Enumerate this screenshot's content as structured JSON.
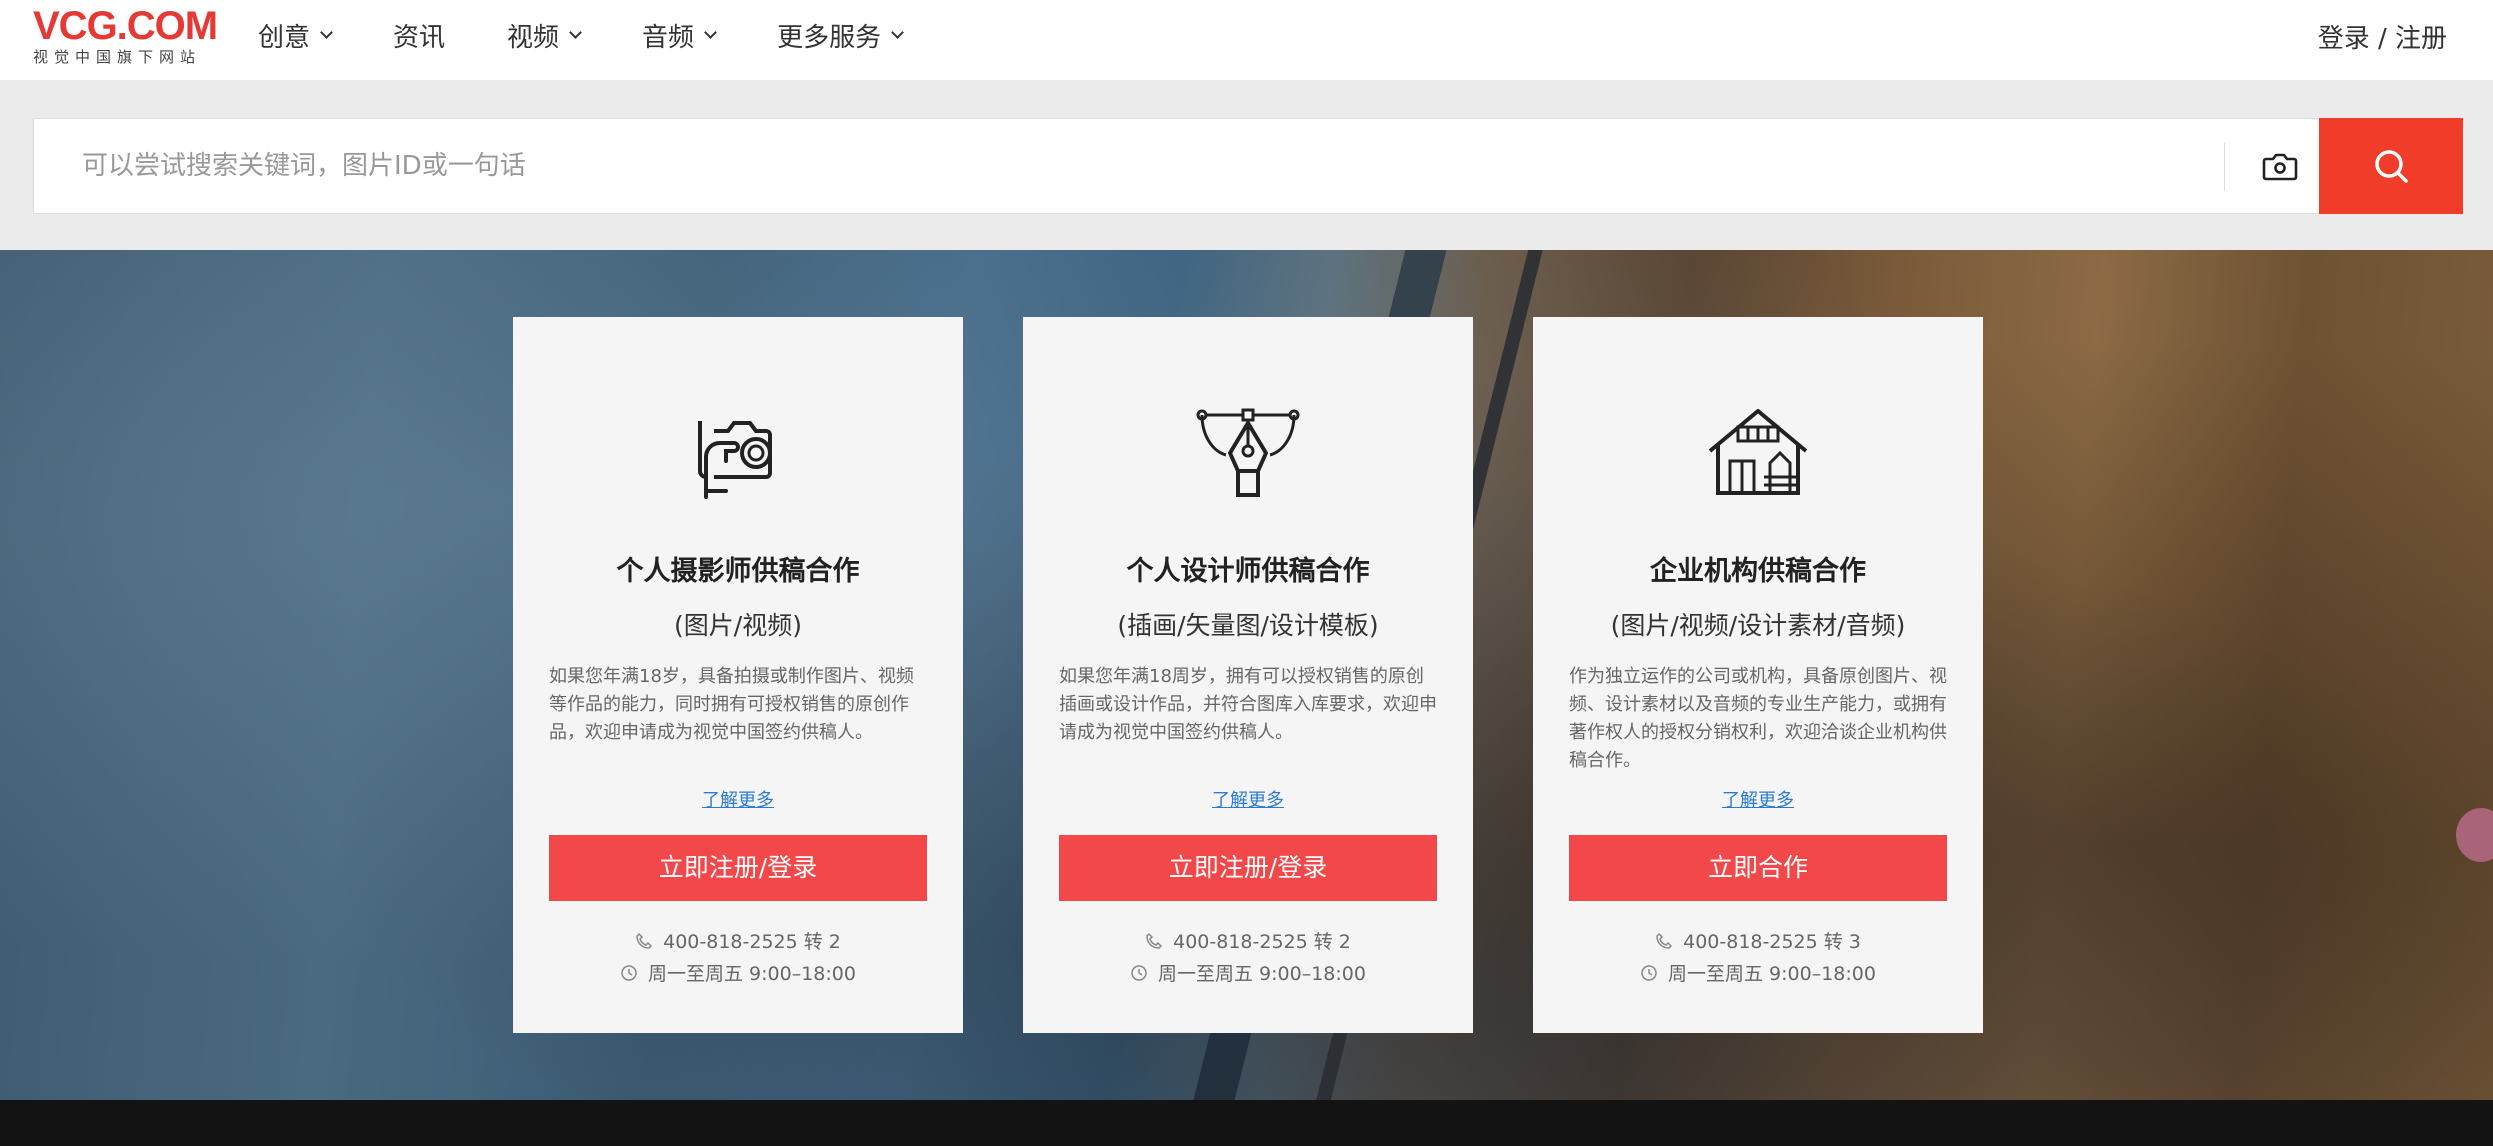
{
  "logo": {
    "main": "VCG.COM",
    "sub": "视觉中国旗下网站"
  },
  "nav": [
    {
      "label": "创意",
      "has_dropdown": true
    },
    {
      "label": "资讯",
      "has_dropdown": false
    },
    {
      "label": "视频",
      "has_dropdown": true
    },
    {
      "label": "音频",
      "has_dropdown": true
    },
    {
      "label": "更多服务",
      "has_dropdown": true
    }
  ],
  "login_label": "登录 / 注册",
  "search": {
    "placeholder": "可以尝试搜索关键词，图片ID或一句话",
    "value": ""
  },
  "colors": {
    "brand": "#e53935",
    "search_button": "#f03c28",
    "card_button": "#f2484a",
    "link": "#2a7bd4"
  },
  "cards": [
    {
      "icon": "camera-hand-icon",
      "title": "个人摄影师供稿合作",
      "subtitle": "(图片/视频)",
      "desc": "如果您年满18岁，具备拍摄或制作图片、视频等作品的能力，同时拥有可授权销售的原创作品，欢迎申请成为视觉中国签约供稿人。",
      "more": "了解更多",
      "button": "立即注册/登录",
      "phone": "400-818-2525 转 2",
      "hours": "周一至周五 9:00–18:00"
    },
    {
      "icon": "pen-tool-icon",
      "title": "个人设计师供稿合作",
      "subtitle": "(插画/矢量图/设计模板)",
      "desc": "如果您年满18周岁，拥有可以授权销售的原创插画或设计作品，并符合图库入库要求，欢迎申请成为视觉中国签约供稿人。",
      "more": "了解更多",
      "button": "立即注册/登录",
      "phone": "400-818-2525 转 2",
      "hours": "周一至周五 9:00–18:00"
    },
    {
      "icon": "building-icon",
      "title": "企业机构供稿合作",
      "subtitle": "(图片/视频/设计素材/音频)",
      "desc": "作为独立运作的公司或机构，具备原创图片、视频、设计素材以及音频的专业生产能力，或拥有著作权人的授权分销权利，欢迎洽谈企业机构供稿合作。",
      "more": "了解更多",
      "button": "立即合作",
      "phone": "400-818-2525 转 3",
      "hours": "周一至周五 9:00–18:00"
    }
  ]
}
